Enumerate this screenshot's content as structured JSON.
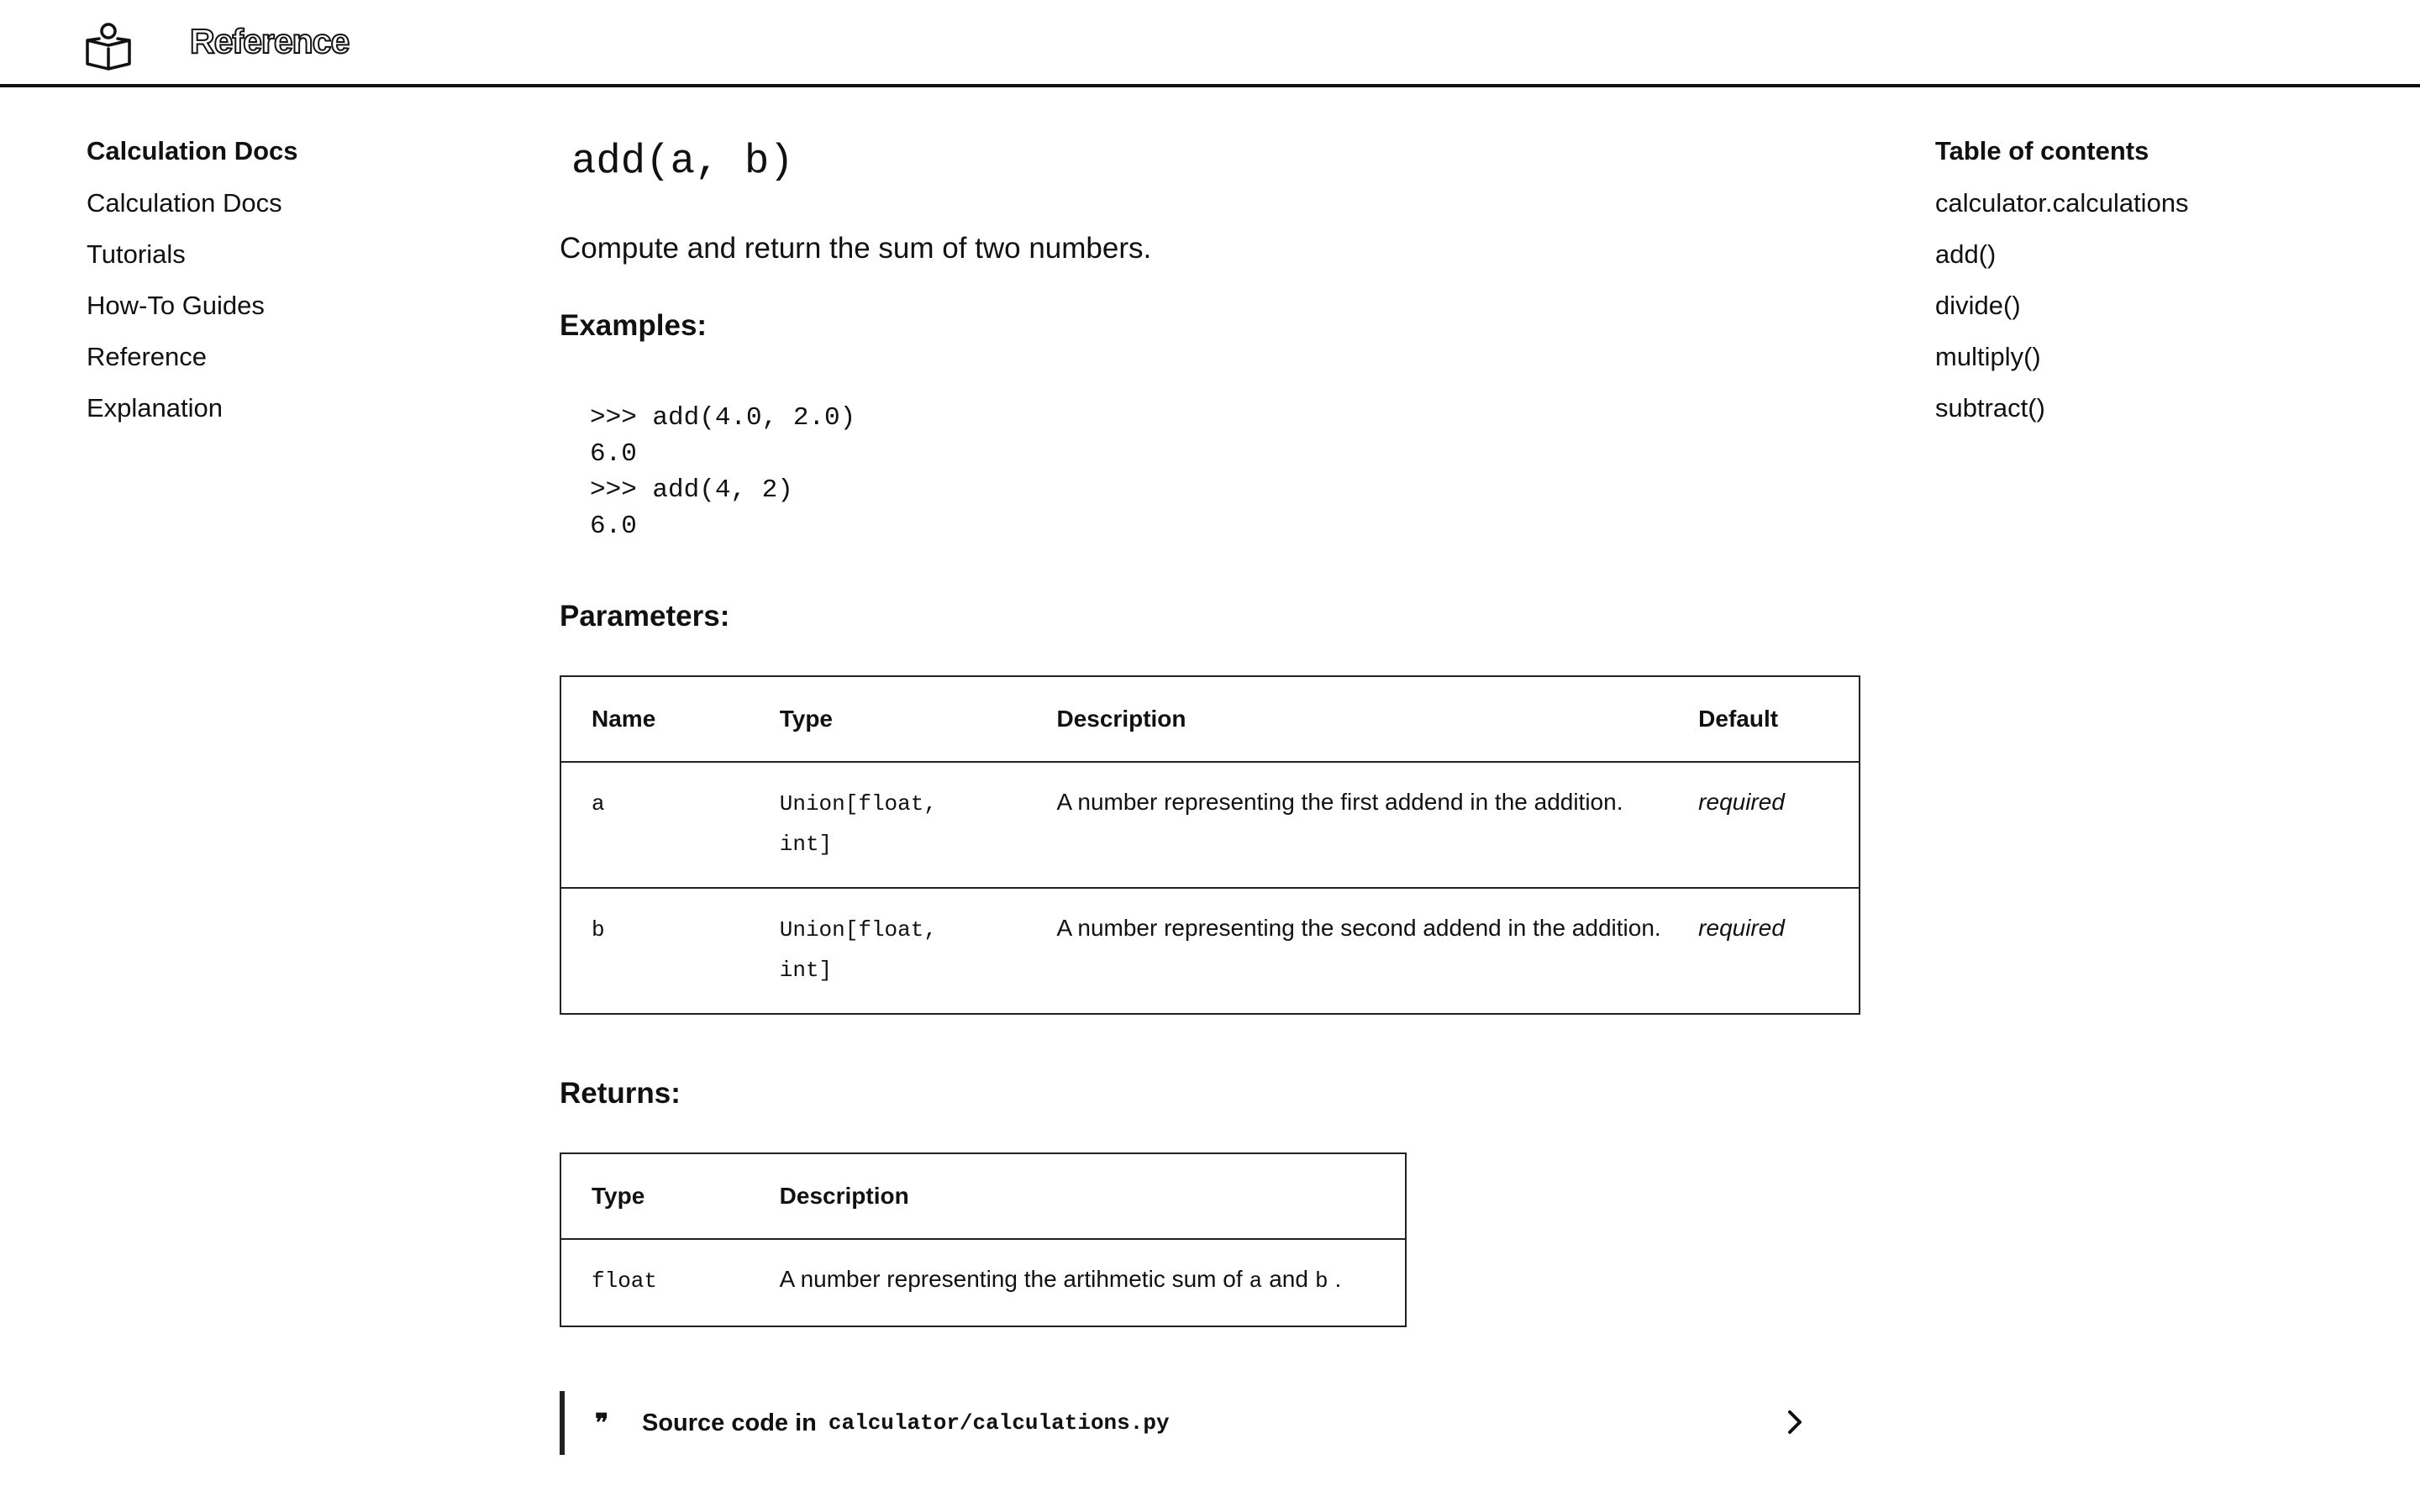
{
  "header": {
    "title": "Reference",
    "logo_icon": "book-reader-icon"
  },
  "nav": {
    "title": "Calculation Docs",
    "items": [
      {
        "label": "Calculation Docs"
      },
      {
        "label": "Tutorials"
      },
      {
        "label": "How-To Guides"
      },
      {
        "label": "Reference"
      },
      {
        "label": "Explanation"
      }
    ]
  },
  "toc": {
    "title": "Table of contents",
    "items": [
      {
        "label": "calculator.calculations"
      },
      {
        "label": "add()"
      },
      {
        "label": "divide()"
      },
      {
        "label": "multiply()"
      },
      {
        "label": "subtract()"
      }
    ]
  },
  "main": {
    "function_signature": "add(a, b)",
    "summary": "Compute and return the sum of two numbers.",
    "examples_heading": "Examples:",
    "examples_code": ">>> add(4.0, 2.0)\n6.0\n>>> add(4, 2)\n6.0",
    "parameters_heading": "Parameters:",
    "parameters_table": {
      "headers": {
        "name": "Name",
        "type": "Type",
        "description": "Description",
        "default": "Default"
      },
      "rows": [
        {
          "name": "a",
          "type_line1": "Union[float,",
          "type_line2": "int]",
          "description": "A number representing the first addend in the addition.",
          "default": "required"
        },
        {
          "name": "b",
          "type_line1": "Union[float,",
          "type_line2": "int]",
          "description": "A number representing the second addend in the addition.",
          "default": "required"
        }
      ]
    },
    "returns_heading": "Returns:",
    "returns_table": {
      "headers": {
        "type": "Type",
        "description": "Description"
      },
      "rows": [
        {
          "type": "float",
          "description_prefix": "A number representing the artihmetic sum of",
          "code_a": "a",
          "description_and": "and",
          "code_b": "b",
          "description_suffix": "."
        }
      ]
    },
    "source": {
      "label": "Source code in",
      "path": "calculator/calculations.py",
      "quote_icon": "quote-icon",
      "toggle_icon": "chevron-right-icon"
    }
  },
  "colors": {
    "text": "#111111",
    "background": "#ffffff",
    "border": "#222222"
  }
}
